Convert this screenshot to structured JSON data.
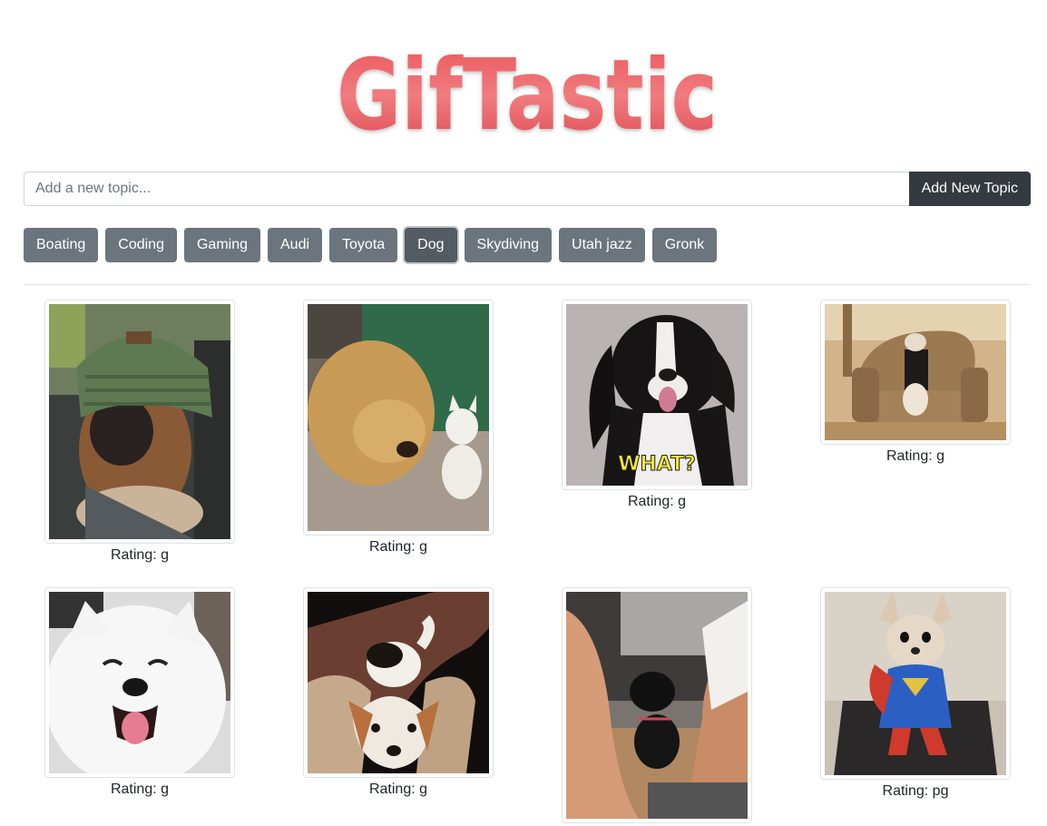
{
  "logo": {
    "text": "GifTastic",
    "color": "#e05258"
  },
  "search": {
    "placeholder": "Add a new topic...",
    "value": "",
    "button_label": "Add New Topic"
  },
  "topics": [
    {
      "label": "Boating"
    },
    {
      "label": "Coding"
    },
    {
      "label": "Gaming"
    },
    {
      "label": "Audi"
    },
    {
      "label": "Toyota"
    },
    {
      "label": "Dog",
      "active": true
    },
    {
      "label": "Skydiving"
    },
    {
      "label": "Utah jazz"
    },
    {
      "label": "Gronk"
    }
  ],
  "gifs": [
    {
      "rating_text": "Rating: g",
      "subject": "dog-in-green-beanie"
    },
    {
      "rating_text": "Rating: g",
      "subject": "golden-retriever-and-kitten"
    },
    {
      "rating_text": "Rating: g",
      "subject": "black-white-dog-what",
      "caption": "WHAT?"
    },
    {
      "rating_text": "Rating: g",
      "subject": "dog-in-armchair"
    },
    {
      "rating_text": "Rating: g",
      "subject": "smiling-samoyed"
    },
    {
      "rating_text": "Rating: g",
      "subject": "beagle-in-cushions"
    },
    {
      "rating_text": "",
      "subject": "small-black-dog"
    },
    {
      "rating_text": "Rating: pg",
      "subject": "chihuahua-superman-treadmill"
    }
  ]
}
